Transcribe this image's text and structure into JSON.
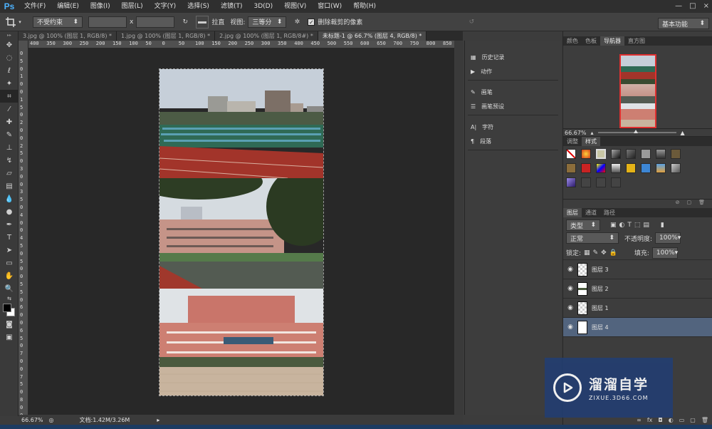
{
  "app": {
    "logo": "Ps"
  },
  "menu": [
    "文件(F)",
    "编辑(E)",
    "图像(I)",
    "图层(L)",
    "文字(Y)",
    "选择(S)",
    "滤镜(T)",
    "3D(D)",
    "视图(V)",
    "窗口(W)",
    "帮助(H)"
  ],
  "window_controls": [
    "—",
    "□",
    "×"
  ],
  "options": {
    "ratio": "不受约束",
    "x_label": "x",
    "straighten": "拉直",
    "view_label": "视图:",
    "view_value": "三等分",
    "delete_cropped": "删除裁剪的像素",
    "workspace": "基本功能"
  },
  "tabs": [
    "3.jpg @ 100% (图层 1, RGB/8) *",
    "1.jpg @ 100% (图层 1, RGB/8) *",
    "2.jpg @ 100% (图层 1, RGB/8#) *",
    "未标题-1 @ 66.7% (图层 4, RGB/8) *"
  ],
  "ruler_top": [
    "400",
    "350",
    "300",
    "250",
    "200",
    "150",
    "100",
    "50",
    "0",
    "50",
    "100",
    "150",
    "200",
    "250",
    "300",
    "350",
    "400",
    "450",
    "500",
    "550",
    "600",
    "650",
    "700",
    "750",
    "800",
    "850"
  ],
  "ruler_left": [
    "0",
    "5",
    "0",
    "1",
    "0",
    "0",
    "1",
    "5",
    "0",
    "2",
    "0",
    "0",
    "2",
    "5",
    "0",
    "3",
    "0",
    "0",
    "3",
    "5",
    "0",
    "4",
    "0",
    "0",
    "4",
    "5",
    "0",
    "5",
    "0",
    "0",
    "5",
    "5",
    "0",
    "6",
    "0",
    "0",
    "6",
    "5",
    "0",
    "7",
    "0",
    "0",
    "7",
    "5",
    "0",
    "8",
    "0",
    "0"
  ],
  "status": {
    "zoom": "66.67%",
    "doc": "文档:1.42M/3.26M"
  },
  "mid_panel": {
    "group1": [
      "历史记录",
      "动作"
    ],
    "group2": [
      "画笔",
      "画笔预设"
    ],
    "group3": [
      "字符",
      "段落"
    ]
  },
  "panel_tabs_top": [
    "颜色",
    "色板",
    "导航器",
    "直方图"
  ],
  "navigator_zoom": "66.67%",
  "panel_tabs_mid": [
    "调整",
    "样式"
  ],
  "panel_tabs_layers": [
    "图层",
    "通道",
    "路径"
  ],
  "layers": {
    "filter_kind": "类型",
    "blend_mode": "正常",
    "opacity_label": "不透明度:",
    "opacity": "100%",
    "lock_label": "锁定:",
    "fill_label": "填充:",
    "fill": "100%",
    "items": [
      "图层 3",
      "图层 2",
      "图层 1",
      "图层 4"
    ]
  },
  "watermark": {
    "title": "溜溜自学",
    "sub": "ZIXUE.3D66.COM"
  },
  "colors": {
    "accent": "#4db3ff",
    "active_layer": "#52647e",
    "nav_frame": "#e03030"
  }
}
